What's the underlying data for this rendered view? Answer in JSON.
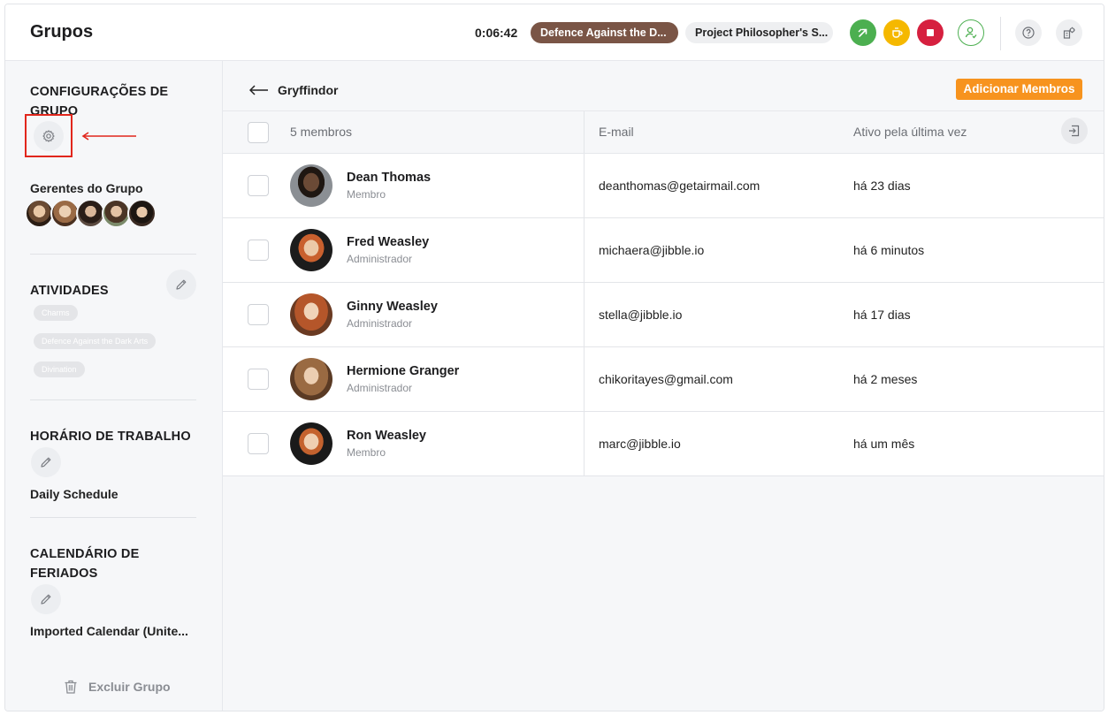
{
  "header": {
    "title": "Grupos",
    "timer": "0:06:42",
    "activity_pill": "Defence Against the D...",
    "project_pill": "Project Philosopher's S...",
    "colors": {
      "green": "#4caf50",
      "yellow": "#f5b800",
      "red": "#d6203f",
      "orange": "#f7931e",
      "activity": "#7a5546"
    }
  },
  "sidebar": {
    "group_settings_heading": "CONFIGURAÇÕES DE GRUPO",
    "managers_heading": "Gerentes do Grupo",
    "activities_heading": "ATIVIDADES",
    "activities": [
      "Charms",
      "Defence Against the Dark Arts",
      "Divination"
    ],
    "work_schedule_heading": "HORÁRIO DE TRABALHO",
    "work_schedule_value": "Daily Schedule",
    "holiday_heading": "CALENDÁRIO DE FERIADOS",
    "holiday_value": "Imported Calendar (Unite...",
    "delete_label": "Excluir Grupo"
  },
  "main": {
    "group_name": "Gryffindor",
    "add_members_label": "Adicionar Membros",
    "columns": {
      "members": "5 membros",
      "email": "E-mail",
      "last_active": "Ativo pela última vez"
    },
    "members": [
      {
        "name": "Dean Thomas",
        "role": "Membro",
        "email": "deanthomas@getairmail.com",
        "last_active": "há 23 dias"
      },
      {
        "name": "Fred Weasley",
        "role": "Administrador",
        "email": "michaera@jibble.io",
        "last_active": "há 6 minutos"
      },
      {
        "name": "Ginny Weasley",
        "role": "Administrador",
        "email": "stella@jibble.io",
        "last_active": "há 17 dias"
      },
      {
        "name": "Hermione Granger",
        "role": "Administrador",
        "email": "chikoritayes@gmail.com",
        "last_active": "há 2 meses"
      },
      {
        "name": "Ron Weasley",
        "role": "Membro",
        "email": "marc@jibble.io",
        "last_active": "há um mês"
      }
    ]
  }
}
